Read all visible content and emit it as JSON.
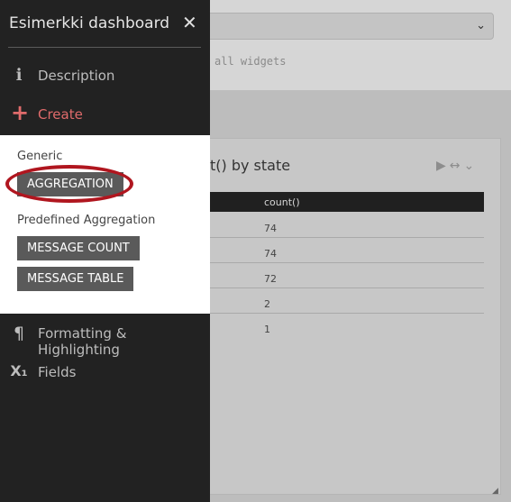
{
  "background": {
    "hint": "all widgets",
    "widget": {
      "title": "t() by state",
      "column_header": "count()",
      "values": [
        "74",
        "74",
        "72",
        "2",
        "1"
      ]
    }
  },
  "sidebar": {
    "title": "Esimerkki dashboard",
    "close_glyph": "✕",
    "items": [
      {
        "label": "Description",
        "icon": "info-icon",
        "glyph": "ℹ"
      },
      {
        "label": "Create",
        "icon": "plus-icon",
        "glyph": "+"
      },
      {
        "label": "Formatting & Highlighting",
        "icon": "paragraph-icon",
        "glyph": "¶"
      },
      {
        "label": "Fields",
        "icon": "subscript-icon",
        "glyph": "X₁"
      }
    ],
    "create_panel": {
      "generic_label": "Generic",
      "generic_buttons": [
        "AGGREGATION"
      ],
      "predefined_label": "Predefined Aggregation",
      "predefined_buttons": [
        "MESSAGE COUNT",
        "MESSAGE TABLE"
      ]
    }
  },
  "colors": {
    "sidebar_bg": "#222222",
    "create_accent": "#e06b6b",
    "button_bg": "#5a5a5a",
    "annotation_ring": "#b0161f"
  }
}
